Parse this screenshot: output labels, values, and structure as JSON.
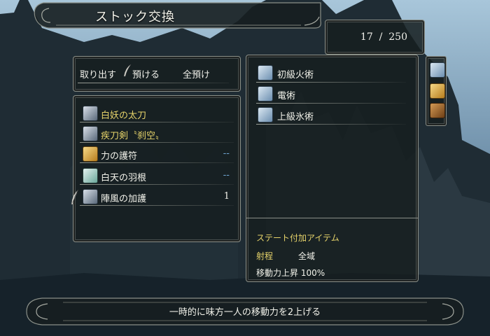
{
  "window": {
    "title": "ストック交換"
  },
  "counter": {
    "current": "17",
    "separator": "/",
    "max": "250"
  },
  "actions": [
    {
      "label": "取り出す"
    },
    {
      "label": "預ける"
    },
    {
      "label": "全預け"
    }
  ],
  "items": [
    {
      "name": "白妖の太刀",
      "icon": "sword-icon",
      "quantity": "",
      "color": "#e6d36a"
    },
    {
      "name": "疾刀剣〝刹空〟",
      "icon": "sword-icon",
      "quantity": "",
      "color": "#e6d36a"
    },
    {
      "name": "力の護符",
      "icon": "amulet-icon",
      "quantity": "--",
      "color": "#f2f2ea"
    },
    {
      "name": "白天の羽根",
      "icon": "feather-icon",
      "quantity": "--",
      "color": "#f2f2ea"
    },
    {
      "name": "陣風の加護",
      "icon": "scroll-icon",
      "quantity": "1",
      "color": "#f2f2ea"
    }
  ],
  "spells": [
    {
      "name": "初級火術",
      "icon": "spell-scroll-icon"
    },
    {
      "name": "電術",
      "icon": "spell-scroll-icon"
    },
    {
      "name": "上級氷術",
      "icon": "spell-scroll-icon"
    }
  ],
  "detail": {
    "category": "ステート付加アイテム",
    "range_label": "射程",
    "range_value": "全域",
    "effect": "移動力上昇 100%"
  },
  "side_tabs": [
    {
      "icon": "spell-scroll-icon"
    },
    {
      "icon": "gold-scroll-icon"
    },
    {
      "icon": "bag-icon"
    }
  ],
  "description": "一時的に味方一人の移動力を2上げる"
}
